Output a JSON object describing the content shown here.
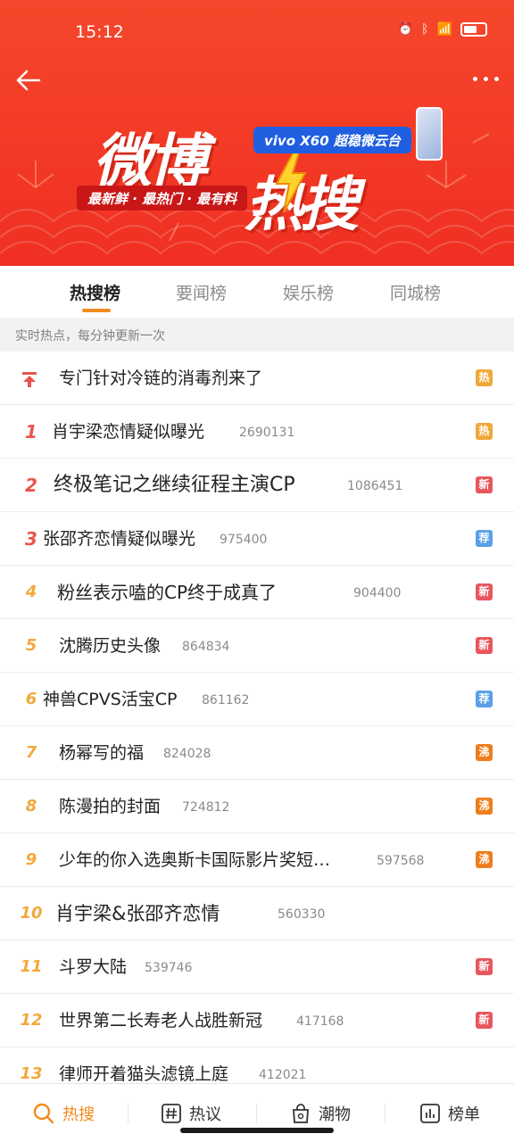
{
  "status": {
    "time": "15:12"
  },
  "banner": {
    "logo_line1": "微博",
    "logo_line2": "热搜",
    "sponsor": "vivo X60 超稳微云台",
    "slogan": "最新鲜 · 最热门 · 最有料"
  },
  "tabs": [
    {
      "label": "热搜榜",
      "active": true
    },
    {
      "label": "要闻榜",
      "active": false
    },
    {
      "label": "娱乐榜",
      "active": false
    },
    {
      "label": "同城榜",
      "active": false
    }
  ],
  "subtitle": "实时热点，每分钟更新一次",
  "pinned": {
    "title": "专门针对冷链的消毒剂来了",
    "badge": "热"
  },
  "items": [
    {
      "rank": "1",
      "title": "肖宇梁恋情疑似曝光",
      "count": "2690131",
      "badge": "热"
    },
    {
      "rank": "2",
      "title": "终极笔记之继续征程主演CP",
      "count": "1086451",
      "badge": "新"
    },
    {
      "rank": "3",
      "title": "张邵齐恋情疑似曝光",
      "count": "975400",
      "badge": "荐"
    },
    {
      "rank": "4",
      "title": "粉丝表示嗑的CP终于成真了",
      "count": "904400",
      "badge": "新"
    },
    {
      "rank": "5",
      "title": "沈腾历史头像",
      "count": "864834",
      "badge": "新"
    },
    {
      "rank": "6",
      "title": "神兽CPVS活宝CP",
      "count": "861162",
      "badge": "荐"
    },
    {
      "rank": "7",
      "title": "杨幂写的福",
      "count": "824028",
      "badge": "沸"
    },
    {
      "rank": "8",
      "title": "陈漫拍的封面",
      "count": "724812",
      "badge": "沸"
    },
    {
      "rank": "9",
      "title": "少年的你入选奥斯卡国际影片奖短…",
      "count": "597568",
      "badge": "沸"
    },
    {
      "rank": "10",
      "title": "肖宇梁&张邵齐恋情",
      "count": "560330",
      "badge": ""
    },
    {
      "rank": "11",
      "title": "斗罗大陆",
      "count": "539746",
      "badge": "新"
    },
    {
      "rank": "12",
      "title": "世界第二长寿老人战胜新冠",
      "count": "417168",
      "badge": "新"
    },
    {
      "rank": "13",
      "title": "律师开着猫头滤镜上庭",
      "count": "412021",
      "badge": ""
    }
  ],
  "badge_colors": {
    "热": "#f0a83a",
    "新": "#e8565e",
    "荐": "#5aa0e8",
    "沸": "#ee7d1c"
  },
  "nav": [
    {
      "label": "热搜",
      "icon": "search-icon",
      "active": true
    },
    {
      "label": "热议",
      "icon": "hashtag-icon",
      "active": false
    },
    {
      "label": "潮物",
      "icon": "shopping-bag-icon",
      "active": false
    },
    {
      "label": "榜单",
      "icon": "chart-icon",
      "active": false
    }
  ]
}
